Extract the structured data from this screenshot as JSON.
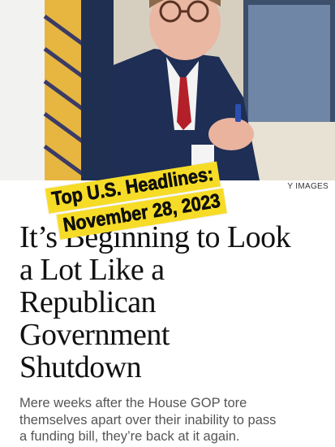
{
  "photo": {
    "alt_icon": "photo-image",
    "credit": "Y IMAGES"
  },
  "article": {
    "headline_lines": [
      "It’s Beginning to Look",
      "a Lot Like a",
      "Republican",
      "Government",
      "Shutdown"
    ],
    "dek_lines": [
      "Mere weeks after the House GOP tore",
      "themselves apart over their inability to pass",
      "a funding bill, they’re back at it again."
    ]
  },
  "overlay": {
    "line1": "Top U.S. Headlines:",
    "line2": "November 28, 2023",
    "color": "#f6dc27"
  }
}
